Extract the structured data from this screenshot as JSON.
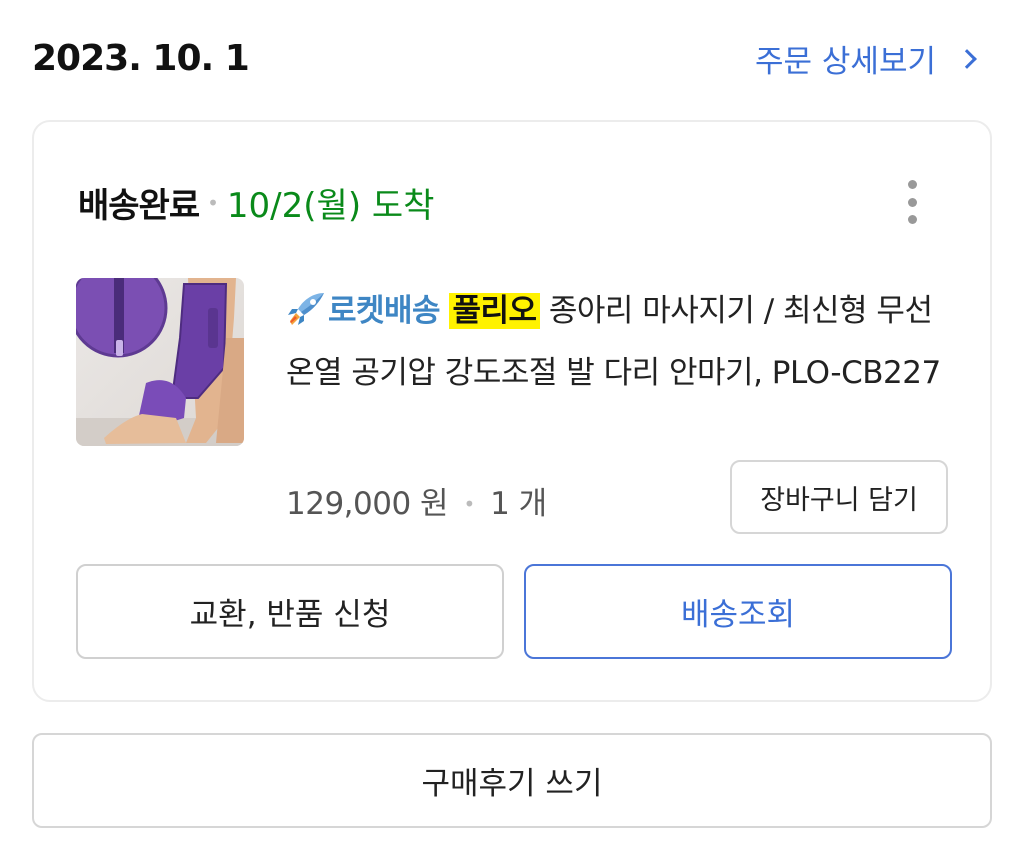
{
  "order": {
    "date": "2023. 10. 1",
    "detail_link_label": "주문 상세보기"
  },
  "delivery": {
    "status": "배송완료",
    "arrival": "10/2(월) 도착"
  },
  "product": {
    "delivery_badge": "로켓배송",
    "brand": "풀리오",
    "name": " 종아리 마사지기 / 최신형 무선 온열 공기압 강도조절 발 다리 안마기, PLO-CB227",
    "price": "129,000 원",
    "quantity": "1 개",
    "cart_button_label": "장바구니 담기"
  },
  "actions": {
    "exchange_label": "교환, 반품 신청",
    "track_label": "배송조회",
    "review_label": "구매후기 쓰기"
  },
  "icons": {
    "rocket": "rocket-icon",
    "more": "more-vertical-icon",
    "chevron": "chevron-right-icon"
  },
  "colors": {
    "link_blue": "#3b6fd6",
    "arrival_green": "#0a8a1a",
    "highlight_yellow": "#fff200",
    "rocket_blue": "#3e86c4"
  }
}
